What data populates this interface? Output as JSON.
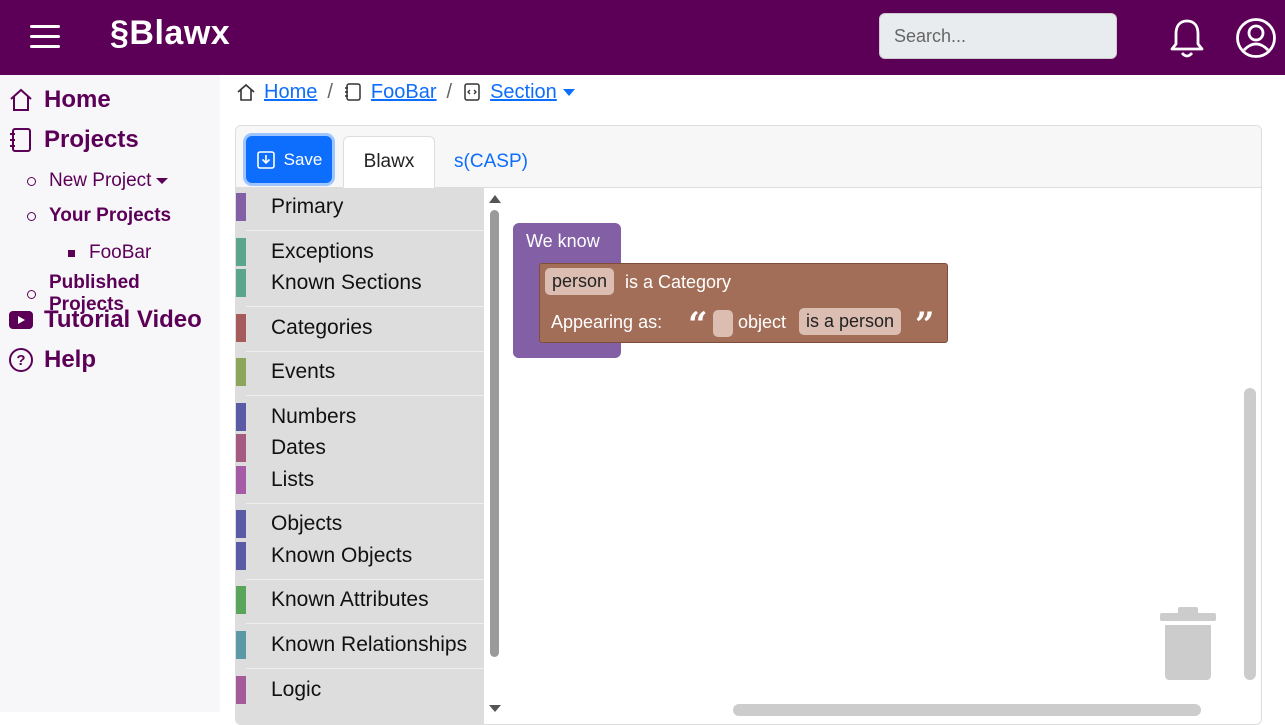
{
  "app": {
    "brand": "§Blawx"
  },
  "search": {
    "placeholder": "Search..."
  },
  "sidebar": {
    "home": "Home",
    "projects": "Projects",
    "new_project": "New Project",
    "your_projects": "Your Projects",
    "project_item": "FooBar",
    "published_projects": "Published Projects",
    "tutorial_video": "Tutorial Video",
    "help": "Help"
  },
  "breadcrumb": {
    "home": "Home",
    "project": "FooBar",
    "section": "Section"
  },
  "editor": {
    "save_label": "Save",
    "tabs": [
      "Blawx",
      "s(CASP)"
    ]
  },
  "toolbox": {
    "items": [
      {
        "label": "Primary",
        "color": "#8360a6"
      },
      {
        "label": "Exceptions",
        "color": "#5ba58c"
      },
      {
        "label": "Known Sections",
        "color": "#5ba58c"
      },
      {
        "label": "Categories",
        "color": "#a55b5b"
      },
      {
        "label": "Events",
        "color": "#8ca55b"
      },
      {
        "label": "Numbers",
        "color": "#5b5ba5"
      },
      {
        "label": "Dates",
        "color": "#a55b80"
      },
      {
        "label": "Lists",
        "color": "#a55ba5"
      },
      {
        "label": "Objects",
        "color": "#5b5ba5"
      },
      {
        "label": "Known Objects",
        "color": "#5b5ba5"
      },
      {
        "label": "Known Attributes",
        "color": "#5ba55b"
      },
      {
        "label": "Known Relationships",
        "color": "#5b99a5"
      },
      {
        "label": "Logic",
        "color": "#a55b99"
      }
    ]
  },
  "workspace": {
    "we_know": "We know",
    "category_field": "person",
    "is_a_category": "is a Category",
    "appearing_as": "Appearing as:",
    "open_quote": "“",
    "object": "object",
    "is_a_person": "is a person",
    "close_quote": "”"
  },
  "colors": {
    "brand": "#5c0057",
    "primary": "#0d6efd",
    "we_know_block": "#8360a6",
    "category_block": "#a36e58"
  }
}
